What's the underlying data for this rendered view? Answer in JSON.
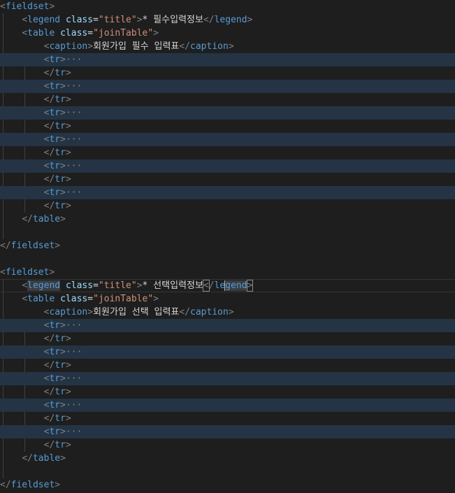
{
  "lines": [
    [
      [
        "br",
        "<"
      ],
      [
        "tg",
        "fieldset"
      ],
      [
        "br",
        ">"
      ]
    ],
    [
      [
        "ws",
        "    "
      ],
      [
        "br",
        "<"
      ],
      [
        "tg",
        "legend"
      ],
      [
        "tx",
        " "
      ],
      [
        "at",
        "class"
      ],
      [
        "eq",
        "="
      ],
      [
        "st",
        "\"title\""
      ],
      [
        "br",
        ">"
      ],
      [
        "tx",
        "* 필수입력정보"
      ],
      [
        "br",
        "</"
      ],
      [
        "tg",
        "legend"
      ],
      [
        "br",
        ">"
      ]
    ],
    [
      [
        "ws",
        "    "
      ],
      [
        "br",
        "<"
      ],
      [
        "tg",
        "table"
      ],
      [
        "tx",
        " "
      ],
      [
        "at",
        "class"
      ],
      [
        "eq",
        "="
      ],
      [
        "st",
        "\"joinTable\""
      ],
      [
        "br",
        ">"
      ]
    ],
    [
      [
        "ws",
        "        "
      ],
      [
        "br",
        "<"
      ],
      [
        "tg",
        "caption"
      ],
      [
        "br",
        ">"
      ],
      [
        "tx",
        "회원가입 필수 입력표"
      ],
      [
        "br",
        "</"
      ],
      [
        "tg",
        "caption"
      ],
      [
        "br",
        ">"
      ]
    ],
    [
      [
        "ws",
        "        "
      ],
      [
        "br",
        "<"
      ],
      [
        "tg",
        "tr"
      ],
      [
        "br",
        ">"
      ],
      [
        "el",
        "···"
      ]
    ],
    [
      [
        "ws",
        "        "
      ],
      [
        "br",
        "</"
      ],
      [
        "tg",
        "tr"
      ],
      [
        "br",
        ">"
      ]
    ],
    [
      [
        "ws",
        "        "
      ],
      [
        "br",
        "<"
      ],
      [
        "tg",
        "tr"
      ],
      [
        "br",
        ">"
      ],
      [
        "el",
        "···"
      ]
    ],
    [
      [
        "ws",
        "        "
      ],
      [
        "br",
        "</"
      ],
      [
        "tg",
        "tr"
      ],
      [
        "br",
        ">"
      ]
    ],
    [
      [
        "ws",
        "        "
      ],
      [
        "br",
        "<"
      ],
      [
        "tg",
        "tr"
      ],
      [
        "br",
        ">"
      ],
      [
        "el",
        "···"
      ]
    ],
    [
      [
        "ws",
        "        "
      ],
      [
        "br",
        "</"
      ],
      [
        "tg",
        "tr"
      ],
      [
        "br",
        ">"
      ]
    ],
    [
      [
        "ws",
        "        "
      ],
      [
        "br",
        "<"
      ],
      [
        "tg",
        "tr"
      ],
      [
        "br",
        ">"
      ],
      [
        "el",
        "···"
      ]
    ],
    [
      [
        "ws",
        "        "
      ],
      [
        "br",
        "</"
      ],
      [
        "tg",
        "tr"
      ],
      [
        "br",
        ">"
      ]
    ],
    [
      [
        "ws",
        "        "
      ],
      [
        "br",
        "<"
      ],
      [
        "tg",
        "tr"
      ],
      [
        "br",
        ">"
      ],
      [
        "el",
        "···"
      ]
    ],
    [
      [
        "ws",
        "        "
      ],
      [
        "br",
        "</"
      ],
      [
        "tg",
        "tr"
      ],
      [
        "br",
        ">"
      ]
    ],
    [
      [
        "ws",
        "        "
      ],
      [
        "br",
        "<"
      ],
      [
        "tg",
        "tr"
      ],
      [
        "br",
        ">"
      ],
      [
        "el",
        "···"
      ]
    ],
    [
      [
        "ws",
        "        "
      ],
      [
        "br",
        "</"
      ],
      [
        "tg",
        "tr"
      ],
      [
        "br",
        ">"
      ]
    ],
    [
      [
        "ws",
        "    "
      ],
      [
        "br",
        "</"
      ],
      [
        "tg",
        "table"
      ],
      [
        "br",
        ">"
      ]
    ],
    [],
    [
      [
        "br",
        "</"
      ],
      [
        "tg",
        "fieldset"
      ],
      [
        "br",
        ">"
      ]
    ],
    [],
    [
      [
        "br",
        "<"
      ],
      [
        "tg",
        "fieldset"
      ],
      [
        "br",
        ">"
      ]
    ],
    [
      [
        "ws",
        "    "
      ],
      [
        "br",
        "<"
      ],
      [
        "tg",
        "legend",
        "hl"
      ],
      [
        "tx",
        " "
      ],
      [
        "at",
        "class"
      ],
      [
        "eq",
        "="
      ],
      [
        "st",
        "\"title\""
      ],
      [
        "br",
        ">"
      ],
      [
        "tx",
        "* 선택입력정보"
      ],
      [
        "br",
        "<",
        "bm"
      ],
      [
        "br",
        "/"
      ],
      [
        "tg",
        "le"
      ],
      [
        "cursor",
        ""
      ],
      [
        "tg",
        "gend",
        "hl"
      ],
      [
        "br",
        ">",
        "bm"
      ]
    ],
    [
      [
        "ws",
        "    "
      ],
      [
        "br",
        "<"
      ],
      [
        "tg",
        "table"
      ],
      [
        "tx",
        " "
      ],
      [
        "at",
        "class"
      ],
      [
        "eq",
        "="
      ],
      [
        "st",
        "\"joinTable\""
      ],
      [
        "br",
        ">"
      ]
    ],
    [
      [
        "ws",
        "        "
      ],
      [
        "br",
        "<"
      ],
      [
        "tg",
        "caption"
      ],
      [
        "br",
        ">"
      ],
      [
        "tx",
        "회원가입 선택 입력표"
      ],
      [
        "br",
        "</"
      ],
      [
        "tg",
        "caption"
      ],
      [
        "br",
        ">"
      ]
    ],
    [
      [
        "ws",
        "        "
      ],
      [
        "br",
        "<"
      ],
      [
        "tg",
        "tr"
      ],
      [
        "br",
        ">"
      ],
      [
        "el",
        "···"
      ]
    ],
    [
      [
        "ws",
        "        "
      ],
      [
        "br",
        "</"
      ],
      [
        "tg",
        "tr"
      ],
      [
        "br",
        ">"
      ]
    ],
    [
      [
        "ws",
        "        "
      ],
      [
        "br",
        "<"
      ],
      [
        "tg",
        "tr"
      ],
      [
        "br",
        ">"
      ],
      [
        "el",
        "···"
      ]
    ],
    [
      [
        "ws",
        "        "
      ],
      [
        "br",
        "</"
      ],
      [
        "tg",
        "tr"
      ],
      [
        "br",
        ">"
      ]
    ],
    [
      [
        "ws",
        "        "
      ],
      [
        "br",
        "<"
      ],
      [
        "tg",
        "tr"
      ],
      [
        "br",
        ">"
      ],
      [
        "el",
        "···"
      ]
    ],
    [
      [
        "ws",
        "        "
      ],
      [
        "br",
        "</"
      ],
      [
        "tg",
        "tr"
      ],
      [
        "br",
        ">"
      ]
    ],
    [
      [
        "ws",
        "        "
      ],
      [
        "br",
        "<"
      ],
      [
        "tg",
        "tr"
      ],
      [
        "br",
        ">"
      ],
      [
        "el",
        "···"
      ]
    ],
    [
      [
        "ws",
        "        "
      ],
      [
        "br",
        "</"
      ],
      [
        "tg",
        "tr"
      ],
      [
        "br",
        ">"
      ]
    ],
    [
      [
        "ws",
        "        "
      ],
      [
        "br",
        "<"
      ],
      [
        "tg",
        "tr"
      ],
      [
        "br",
        ">"
      ],
      [
        "el",
        "···"
      ]
    ],
    [
      [
        "ws",
        "        "
      ],
      [
        "br",
        "</"
      ],
      [
        "tg",
        "tr"
      ],
      [
        "br",
        ">"
      ]
    ],
    [
      [
        "ws",
        "    "
      ],
      [
        "br",
        "</"
      ],
      [
        "tg",
        "table"
      ],
      [
        "br",
        ">"
      ]
    ],
    [],
    [
      [
        "br",
        "</"
      ],
      [
        "tg",
        "fieldset"
      ],
      [
        "br",
        ">"
      ]
    ]
  ],
  "folded_lines": [
    4,
    6,
    8,
    10,
    12,
    14,
    24,
    26,
    28,
    30,
    32
  ],
  "active_line": 21,
  "colors": {
    "background": "#1e1e1e",
    "folded_line_background": "#243444",
    "tag": "#569cd6",
    "attribute": "#9cdcfe",
    "string": "#ce9178",
    "bracket": "#808080",
    "text": "#d4d4d4"
  }
}
